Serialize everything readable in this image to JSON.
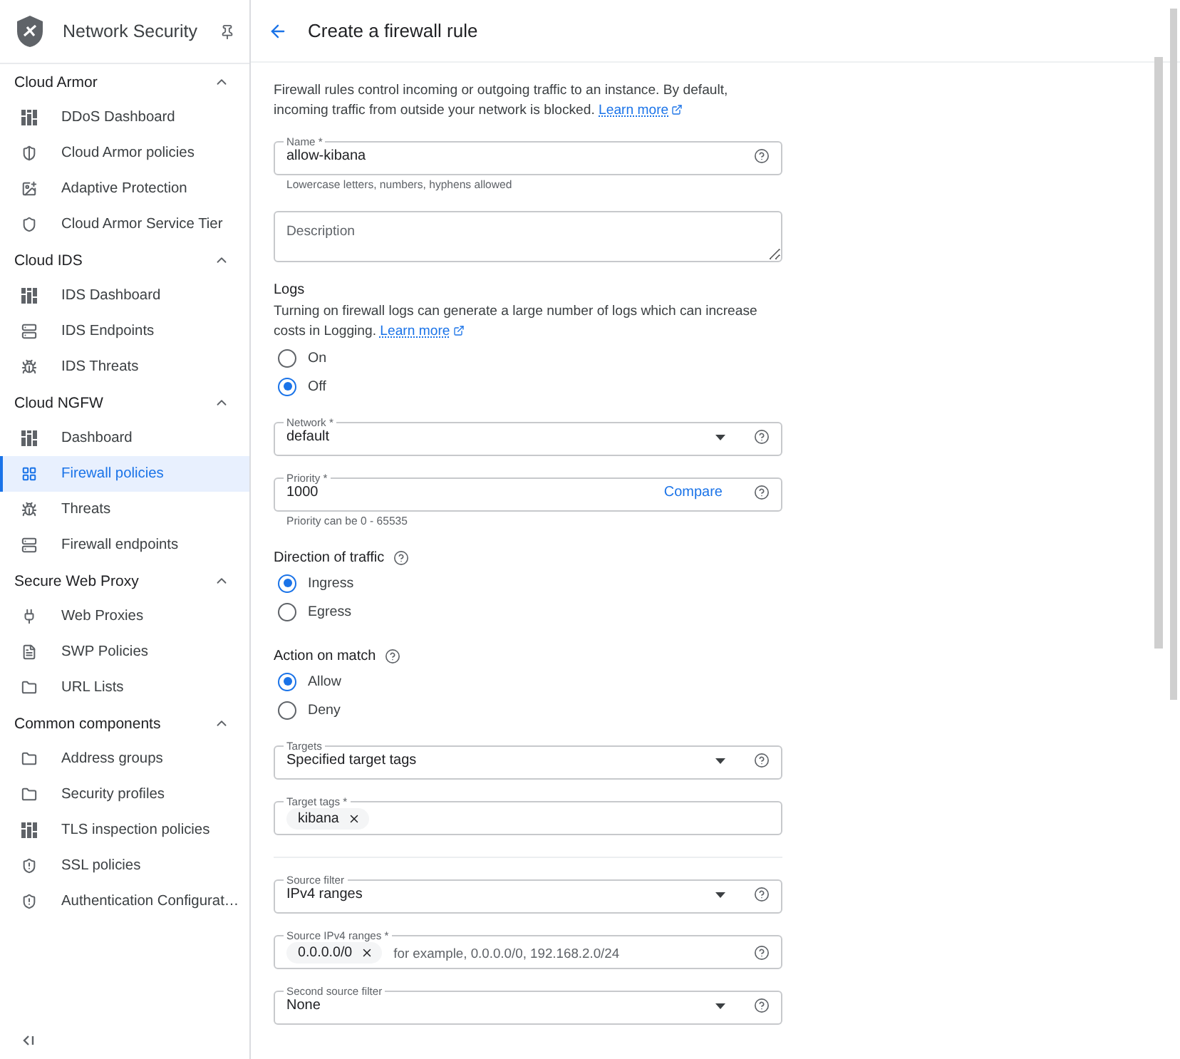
{
  "sidebar": {
    "title": "Network Security",
    "sections": [
      {
        "title": "Cloud Armor",
        "expanded": true,
        "items": [
          {
            "label": "DDoS Dashboard",
            "kind": "dashboard",
            "selected": false
          },
          {
            "label": "Cloud Armor policies",
            "kind": "policy",
            "selected": false
          },
          {
            "label": "Adaptive Protection",
            "kind": "adaptive",
            "selected": false
          },
          {
            "label": "Cloud Armor Service Tier",
            "kind": "tier",
            "selected": false
          }
        ]
      },
      {
        "title": "Cloud IDS",
        "expanded": true,
        "items": [
          {
            "label": "IDS Dashboard",
            "kind": "dashboard",
            "selected": false
          },
          {
            "label": "IDS Endpoints",
            "kind": "endpoint",
            "selected": false
          },
          {
            "label": "IDS Threats",
            "kind": "threat",
            "selected": false
          }
        ]
      },
      {
        "title": "Cloud NGFW",
        "expanded": true,
        "items": [
          {
            "label": "Dashboard",
            "kind": "dashboard",
            "selected": false
          },
          {
            "label": "Firewall policies",
            "kind": "grid",
            "selected": true
          },
          {
            "label": "Threats",
            "kind": "threat",
            "selected": false
          },
          {
            "label": "Firewall endpoints",
            "kind": "endpoint",
            "selected": false
          }
        ]
      },
      {
        "title": "Secure Web Proxy",
        "expanded": true,
        "items": [
          {
            "label": "Web Proxies",
            "kind": "proxy",
            "selected": false
          },
          {
            "label": "SWP Policies",
            "kind": "list",
            "selected": false
          },
          {
            "label": "URL Lists",
            "kind": "folder",
            "selected": false
          }
        ]
      },
      {
        "title": "Common components",
        "expanded": true,
        "items": [
          {
            "label": "Address groups",
            "kind": "folder",
            "selected": false
          },
          {
            "label": "Security profiles",
            "kind": "folder",
            "selected": false
          },
          {
            "label": "TLS inspection policies",
            "kind": "dashboard",
            "selected": false
          },
          {
            "label": "SSL policies",
            "kind": "shield",
            "selected": false
          },
          {
            "label": "Authentication Configurat…",
            "kind": "shield",
            "selected": false
          }
        ]
      }
    ]
  },
  "header": {
    "title": "Create a firewall rule"
  },
  "form": [
    {
      "kind": "paragraph",
      "text": "Firewall rules control incoming or outgoing traffic to an instance. By default, incoming traffic from outside your network is blocked.",
      "link": "Learn more"
    },
    {
      "kind": "input",
      "label": "Name *",
      "value": "allow-kibana",
      "help": true,
      "hint": "Lowercase letters, numbers, hyphens allowed"
    },
    {
      "kind": "textarea",
      "placeholder": "Description"
    },
    {
      "kind": "radio-group",
      "title": "Logs",
      "help": false,
      "text": "Turning on firewall logs can generate a large number of logs which can increase costs in Logging.",
      "link": "Learn more",
      "options": [
        {
          "label": "On",
          "selected": false
        },
        {
          "label": "Off",
          "selected": true
        }
      ]
    },
    {
      "kind": "select",
      "label": "Network *",
      "value": "default",
      "help": true
    },
    {
      "kind": "input",
      "label": "Priority *",
      "value": "1000",
      "action": "Compare",
      "help": true,
      "hint": "Priority can be 0 - 65535"
    },
    {
      "kind": "radio-group",
      "title": "Direction of traffic",
      "help": true,
      "options": [
        {
          "label": "Ingress",
          "selected": true
        },
        {
          "label": "Egress",
          "selected": false
        }
      ]
    },
    {
      "kind": "radio-group",
      "title": "Action on match",
      "help": true,
      "options": [
        {
          "label": "Allow",
          "selected": true
        },
        {
          "label": "Deny",
          "selected": false
        }
      ]
    },
    {
      "kind": "select",
      "label": "Targets",
      "value": "Specified target tags",
      "help": true
    },
    {
      "kind": "chips",
      "label": "Target tags *",
      "chips": [
        "kibana"
      ],
      "help": false
    },
    {
      "kind": "divider"
    },
    {
      "kind": "select",
      "label": "Source filter",
      "value": "IPv4 ranges",
      "help": true
    },
    {
      "kind": "chips",
      "label": "Source IPv4 ranges *",
      "chips": [
        "0.0.0.0/0"
      ],
      "placeholder": "for example, 0.0.0.0/0, 192.168.2.0/24",
      "help": true
    },
    {
      "kind": "select",
      "label": "Second source filter",
      "value": "None",
      "help": true
    }
  ]
}
